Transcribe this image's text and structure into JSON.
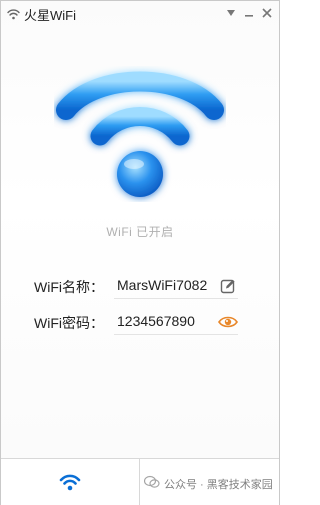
{
  "window": {
    "title": "火星WiFi"
  },
  "titlebar": {
    "dropdown_icon": "chevron-down-icon",
    "minimize_icon": "minimize-icon",
    "close_icon": "close-icon"
  },
  "status": {
    "text": "WiFi 已开启"
  },
  "fields": {
    "name_label": "WiFi名称：",
    "name_value": "MarsWiFi7082",
    "name_action_icon": "edit-icon",
    "password_label": "WiFi密码：",
    "password_value": "1234567890",
    "password_action_icon": "eye-icon"
  },
  "bottom": {
    "tab_icon": "wifi-icon",
    "watermark_text": "公众号 · 黑客技术家园"
  },
  "colors": {
    "accent_blue": "#1f8ff0",
    "accent_dark_blue": "#0a6fd6",
    "eye_orange": "#e8872a",
    "status_gray": "#b0b0b0"
  }
}
